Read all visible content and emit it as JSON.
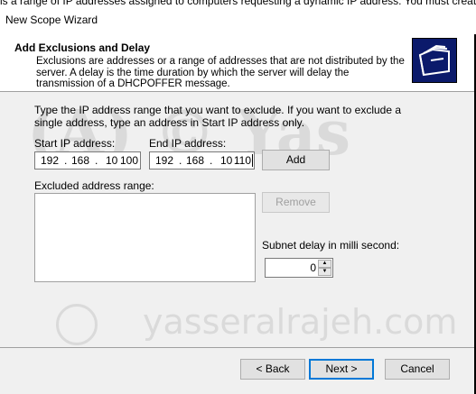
{
  "background_text": "is a range of IP addresses assigned to computers requesting a dynamic IP address. You must create",
  "window": {
    "title": "New Scope Wizard"
  },
  "header": {
    "title": "Add Exclusions and Delay",
    "description": "Exclusions are addresses or a range of addresses that are not distributed by the server. A delay is the time duration by which the server will delay the transmission of a DHCPOFFER message.",
    "icon": "folder-stack-icon"
  },
  "instructions": "Type the IP address range that you want to exclude. If you want to exclude a single address, type an address in Start IP address only.",
  "start_ip": {
    "label": "Start IP address:",
    "octets": [
      "192",
      "168",
      "10",
      "100"
    ]
  },
  "end_ip": {
    "label": "End IP address:",
    "octets": [
      "192",
      "168",
      "10",
      "110"
    ]
  },
  "buttons": {
    "add": "Add",
    "remove": "Remove",
    "back": "< Back",
    "next": "Next >",
    "cancel": "Cancel"
  },
  "excluded_range": {
    "label": "Excluded address range:",
    "items": []
  },
  "subnet_delay": {
    "label": "Subnet delay in milli second:",
    "value": "0"
  },
  "watermark": {
    "main": "(A) © Yas",
    "url": "yasseralrajeh.com"
  }
}
